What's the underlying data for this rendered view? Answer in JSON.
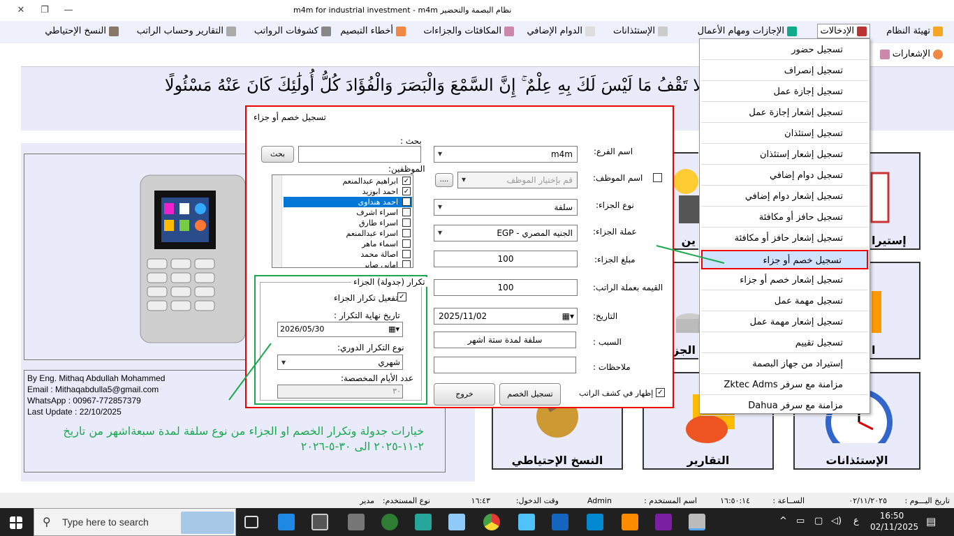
{
  "window": {
    "title": "nizam_title",
    "title_text": "m4m for industrial investment - m4m   نظام البصمة والتحضير"
  },
  "menu": {
    "items": [
      "تهيئة النظام",
      "الإدخالات",
      "الإجازات ومهام الأعمال",
      "الإستئذانات",
      "الدوام الإضافي",
      "المكافئات والجزاءات",
      "أخطاء التبصيم",
      "كشوفات الرواتب",
      "التقارير وحساب الراتب",
      "النسخ الإحتياطي"
    ],
    "notifications": "الإشعارات"
  },
  "quote": "لا تَقْفُ مَا لَيْسَ لَكَ بِهِ عِلْمٌ ۚ إِنَّ السَّمْعَ وَالْبَصَرَ وَالْفُؤَادَ كُلُّ أُولَٰئِكَ كَانَ عَنْهُ مَسْئُولًا",
  "info": {
    "author": "By Eng. Mithaq Abdullah Mohammed",
    "email": "Email : Mithaqabdulla5@gmail.com",
    "whatsapp": "WhatsApp : 00967-772857379",
    "update": "Last Update : 22/10/2025",
    "note": "خيارات جدولة وتكرار الخصم او الجزاء من نوع سلفة لمدة سبعةاشهر من تاريخ ٢-١١-٢٠٢٥ الى ٣٠-٥-٢٠٢٦"
  },
  "tiles": {
    "backup": "النسخ الإحتياطي",
    "reports": "التقارير",
    "permissions": "الإستئذانات",
    "import": "إستيرا",
    "emp": "ين",
    "penal": "الجزاء",
    "x": "ا"
  },
  "dropdown": {
    "items": [
      "تسجيل حضور",
      "تسجيل إنصراف",
      "تسجيل إجازة عمل",
      "تسجيل إشعار إجازة عمل",
      "تسجيل إستئذان",
      "تسجيل إشعار إستئذان",
      "تسجيل دوام إضافي",
      "تسجيل إشعار دوام إضافي",
      "تسجيل حافز أو مكافئة",
      "تسجيل إشعار حافز أو مكافئة",
      "تسجيل خصم أو جزاء",
      "تسجيل إشعار خصم أو جزاء",
      "تسجيل مهمة عمل",
      "تسجيل إشعار مهمة عمل",
      "تسجيل تقييم",
      "إستيراد من جهاز البصمة",
      "مزامنة مع سرفر Zktec Adms",
      "مزامنة مع سرفر Dahua"
    ],
    "selected_index": 10
  },
  "dialog": {
    "title": "تسجيل خصم أو جزاء",
    "search_label": "بحث :",
    "search_button": "بحث",
    "employees_label": "الموظفين:",
    "employees": [
      {
        "name": "ابراهيم عبدالمنعم",
        "checked": true
      },
      {
        "name": "احمد ابوزيد",
        "checked": true
      },
      {
        "name": "احمد هنداوى",
        "checked": true
      },
      {
        "name": "اسراء اشرف",
        "checked": false
      },
      {
        "name": "اسراء طارق",
        "checked": false
      },
      {
        "name": "اسراء عبدالمنعم",
        "checked": false
      },
      {
        "name": "اسماء ماهر",
        "checked": false
      },
      {
        "name": "اصالة محمد",
        "checked": false
      },
      {
        "name": "امانى صابر",
        "checked": false
      }
    ],
    "branch_label": "اسم الفرع:",
    "branch_value": "m4m",
    "employee_label": "اسم الموظف:",
    "employee_placeholder": "قم بإختيار الموظف",
    "employee_browse": "....",
    "type_label": "نوع الجزاء:",
    "type_value": "سلفة",
    "currency_label": "عملة الجزاء:",
    "currency_value": "الجنيه المصري - EGP",
    "amount_label": "مبلغ الجزاء:",
    "amount_value": "100",
    "salary_value_label": "القيمه بعملة  الراتب:",
    "salary_value": "100",
    "date_label": "التاريخ:",
    "date_value": "2025/11/02",
    "reason_label": "السبب :",
    "reason_value": "سلفة لمدة ستة اشهر",
    "notes_label": "ملاحظات :",
    "notes_value": "",
    "show_in_payslip": "إظهار في كشف الراتب",
    "save_button": "تسجيل الخصم",
    "exit_button": "خروج",
    "repeat_group": "تكرار (جدولة) الجزاء",
    "repeat_enable": "تفعيل تكرار الجزاء",
    "repeat_end_label": "تاريخ نهاية التكرار :",
    "repeat_end_value": "2026/05/30",
    "repeat_type_label": "نوع التكرار الدوري:",
    "repeat_type_value": "شهري",
    "days_label": "عدد الأيام المخصصة:",
    "days_value": "٣٠"
  },
  "status": {
    "date_label": "تاريخ اليـــوم :",
    "date_value": "٠٢/١١/٢٠٢٥",
    "time_label": "الســاعة :",
    "time_value": "١٦:٥٠:١٤",
    "user_label": "اسم المستخدم :",
    "user_value": "Admin",
    "login_label": "وقت الدخول:",
    "login_value": "١٦:٤٣",
    "type_label": "نوع المستخدم:",
    "type_value": "مدير"
  },
  "taskbar": {
    "search_placeholder": "Type here to search",
    "time": "16:50",
    "date": "02/11/2025",
    "lang": "ع"
  }
}
